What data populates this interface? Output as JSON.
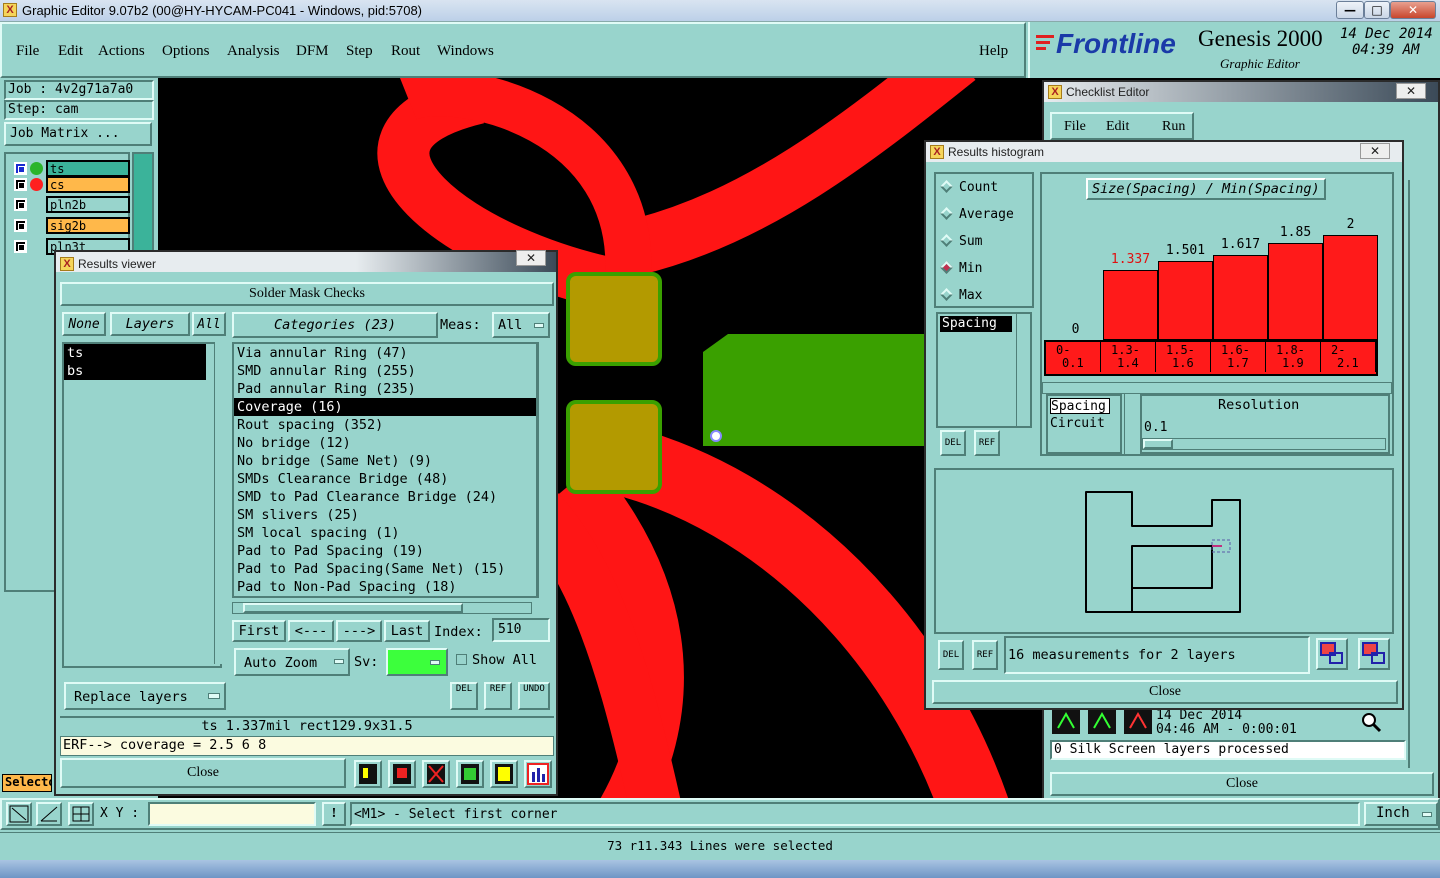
{
  "window": {
    "title": "Graphic Editor 9.07b2 (00@HY-HYCAM-PC041 - Windows, pid:5708)",
    "controls": [
      "—",
      "□",
      "✕"
    ]
  },
  "menu": [
    "File",
    "Edit",
    "Actions",
    "Options",
    "Analysis",
    "DFM",
    "Step",
    "Rout",
    "Windows"
  ],
  "help": "Help",
  "brand": {
    "logo": "Frontline",
    "product": "Genesis 2000",
    "subtitle": "Graphic Editor",
    "date": "14 Dec 2014",
    "time": "04:39 AM"
  },
  "left_panel": {
    "job": "Job : 4v2g71a7a0",
    "step": "Step: cam",
    "job_matrix": "Job Matrix ...",
    "layers": [
      {
        "name": "ts",
        "color": "#2bb52b",
        "bg": "#3bb39a"
      },
      {
        "name": "cs",
        "color": "#ff2020",
        "bg": "#ffb84a"
      },
      {
        "name": "pln2b",
        "color": "",
        "bg": "#98d4cc"
      },
      {
        "name": "sig2b",
        "color": "",
        "bg": "#ffb84a"
      },
      {
        "name": "pln3t",
        "color": "",
        "bg": "#98d4cc"
      }
    ],
    "select_label": "Selecto"
  },
  "checklist": {
    "title": "Checklist Editor",
    "menu": [
      "File",
      "Edit",
      "Run"
    ],
    "date": "14 Dec 2014",
    "time": "04:46 AM - 0:00:01",
    "status": "0 Silk Screen layers processed",
    "close": "Close"
  },
  "results_viewer": {
    "title": "Results viewer",
    "heading": "Solder Mask Checks",
    "none": "None",
    "layers": "Layers",
    "all": "All",
    "layer_list": [
      "ts",
      "bs"
    ],
    "categories_label": "Categories (23)",
    "meas_label": "Meas:",
    "meas_value": "All",
    "categories": [
      "Via annular Ring (47)",
      "SMD annular Ring (255)",
      "Pad annular Ring (235)",
      "Coverage (16)",
      "Rout spacing (352)",
      "No bridge (12)",
      "No bridge (Same Net) (9)",
      "SMDs Clearance Bridge (48)",
      "SMD to Pad Clearance Bridge (24)",
      "SM slivers (25)",
      "SM local spacing (1)",
      "Pad to Pad Spacing (19)",
      "Pad to Pad Spacing(Same Net) (15)",
      "Pad to Non-Pad Spacing (18)"
    ],
    "selected_category": 3,
    "nav": [
      "First",
      "<---",
      "--->",
      "Last"
    ],
    "index_label": "Index:",
    "index_value": "510",
    "auto_zoom": "Auto Zoom",
    "sv_label": "Sv:",
    "show_all": "Show All",
    "replace_layers": "Replace layers",
    "del": "DEL",
    "ref": "REF",
    "undo": "UNDO",
    "info": "ts 1.337mil  rect129.9x31.5",
    "erf": "ERF--> coverage = 2.5 6 8",
    "close": "Close"
  },
  "histogram": {
    "title": "Results histogram",
    "modes": [
      "Count",
      "Average",
      "Sum",
      "Min",
      "Max"
    ],
    "selected_mode": "Min",
    "measure_list": [
      "Spacing"
    ],
    "chart_title": "Size(Spacing) / Min(Spacing)",
    "resolution_types": [
      "Spacing",
      "Circuit"
    ],
    "resolution_label": "Resolution",
    "resolution_value": "0.1",
    "measurements": "16 measurements for 2 layers",
    "close": "Close",
    "del": "DEL",
    "ref": "REF"
  },
  "chart_data": {
    "type": "bar",
    "title": "Size(Spacing) / Min(Spacing)",
    "categories": [
      "0-0.1",
      "1.3-1.4",
      "1.5-1.6",
      "1.6-1.7",
      "1.8-1.9",
      "2-2.1"
    ],
    "bucket_labels": [
      [
        "0-",
        "0.1"
      ],
      [
        "1.3-",
        "1.4"
      ],
      [
        "1.5-",
        "1.6"
      ],
      [
        "1.6-",
        "1.7"
      ],
      [
        "1.8-",
        "1.9"
      ],
      [
        "2-",
        "2.1"
      ]
    ],
    "values": [
      0,
      1.337,
      1.501,
      1.617,
      1.85,
      2
    ],
    "value_labels": [
      "0",
      "1.337",
      "1.501",
      "1.617",
      "1.85",
      "2"
    ],
    "highlight_index": 1,
    "ylim": [
      0,
      2.1
    ],
    "bar_color": "#ff1a1a"
  },
  "status": {
    "xy_label": "X Y :",
    "xy_value": "",
    "prompt": "<M1> - Select first corner",
    "units": "Inch",
    "message": "73 r11.343 Lines were selected"
  }
}
